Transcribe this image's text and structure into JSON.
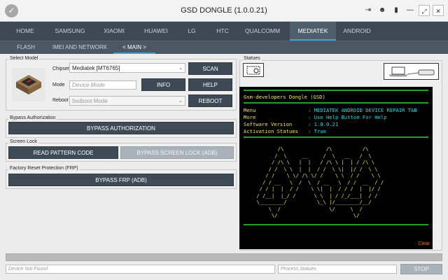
{
  "app": {
    "title": "GSD DONGLE (1.0.0.21)",
    "logo_icon": "check-circle-icon"
  },
  "window_controls": [
    {
      "name": "login-icon",
      "glyph": "⇥"
    },
    {
      "name": "user-icon",
      "glyph": "👤"
    },
    {
      "name": "chat-icon",
      "glyph": "▪"
    },
    {
      "name": "minimize-icon",
      "glyph": "—"
    },
    {
      "name": "maximize-icon",
      "glyph": "⤢"
    },
    {
      "name": "close-icon",
      "glyph": "✕"
    }
  ],
  "top_nav": [
    "HOME",
    "SAMSUNG",
    "XIAOMI",
    "HUAWEI",
    "LG",
    "HTC",
    "QUALCOMM",
    "MEDIATEK",
    "ANDROID"
  ],
  "top_nav_active": "MEDIATEK",
  "sub_nav": [
    "FLASH",
    "IMEI AND NETWORK",
    "< MAIN >"
  ],
  "sub_nav_active": "< MAIN >",
  "select_model": {
    "title": "Select Model",
    "chipset_label": "Chipset",
    "chipset_value": "Mediatek [MT6765]",
    "mode_label": "Mode",
    "mode_placeholder": "Device Mode",
    "reboot_label": "Reboot",
    "reboot_value": "fastboot Mode",
    "scan": "SCAN",
    "info": "INFO",
    "help": "HELP",
    "reboot": "REBOOT"
  },
  "bypass_auth": {
    "title": "Bypass Authorization",
    "button": "BYPASS AUTHORIZATION"
  },
  "screen_lock": {
    "title": "Screen Lock",
    "read_pattern": "READ PATTERN CODE",
    "bypass_lock": "BYPASS SCREEN LOCK (ADB)"
  },
  "frp": {
    "title": "Factory Reset Protection (FRP)",
    "button": "BYPASS FRP (ADB)"
  },
  "statues": {
    "title": "Statues",
    "clear": "Clear"
  },
  "terminal": {
    "header": "Gsm-developers Dongle (GSD)",
    "rows": [
      {
        "key": "Menu",
        "value": ": MEDIATEK ANDROID DEVICE REPAIR TAB"
      },
      {
        "key": "More",
        "value": ": Use Help Button For Help"
      },
      {
        "key": "Software Version",
        "value": ": 1.0.0.21"
      },
      {
        "key": "Activation Statues",
        "value": ": True"
      }
    ],
    "ascii_art": [
      "        /\\              /\\          /\\",
      "       /  \\     __     /  \\   __   /  \\",
      "      / /\\ \\   |  |   / /\\ \\ |  | / /\\ \\",
      "     / /  \\ \\  |  |  / /  \\ \\|  |/ /  \\ \\",
      "    / /    \\ \\/ /\\ \\/ /    \\ \\  / /    \\ \\",
      "   / / __   \\  /  \\  / __   \\  / /  __  / /",
      "  / / |  |  / /    \\ \\|  |  / / /  |  |/ /",
      " / /__|  |_/ /      \\ \\  | / /_/___|  / /",
      " \\________/          \\_\\ |/________/__/",
      "     \\  /                \\/     \\  /",
      "      \\/                         \\/"
    ]
  },
  "bottom": {
    "device_placeholder": "Device Not Found",
    "process_placeholder": "Process Statues",
    "stop": "STOP"
  },
  "colors": {
    "nav_bg": "#3d4a55",
    "accent": "#3aa0d8",
    "terminal_green": "#1fa12a",
    "terminal_yellow": "#f3e65a",
    "terminal_cyan": "#2fd9e8"
  }
}
